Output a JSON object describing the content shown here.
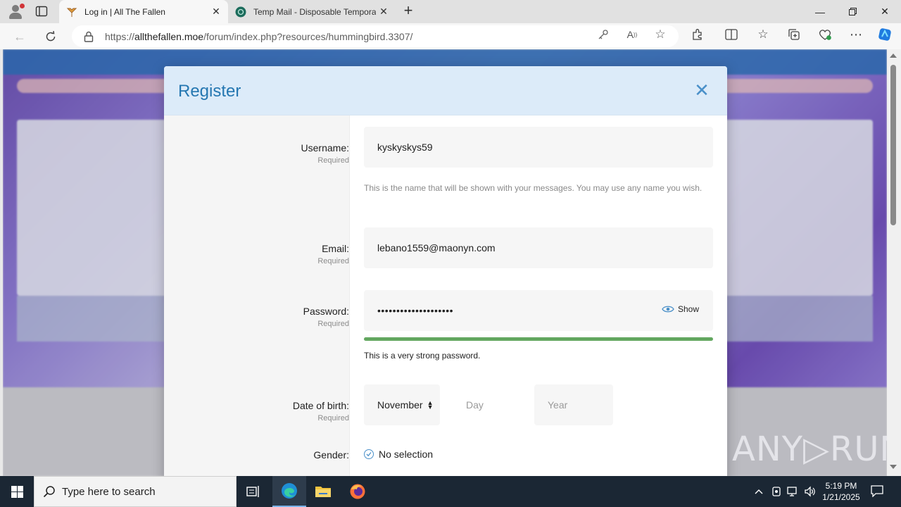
{
  "browser": {
    "tabs": [
      {
        "title": "Log in | All The Fallen",
        "active": true
      },
      {
        "title": "Temp Mail - Disposable Tempora",
        "active": false
      }
    ],
    "url_domain": "allthefallen.moe",
    "url_prefix": "https://",
    "url_path": "/forum/index.php?resources/hummingbird.3307/"
  },
  "modal": {
    "title": "Register",
    "close_glyph": "✕",
    "fields": {
      "username": {
        "label": "Username:",
        "required": "Required",
        "value": "kyskyskys59",
        "hint": "This is the name that will be shown with your messages. You may use any name you wish."
      },
      "email": {
        "label": "Email:",
        "required": "Required",
        "value": "lebano1559@maonyn.com"
      },
      "password": {
        "label": "Password:",
        "required": "Required",
        "value": "••••••••••••••••••••",
        "show_label": "Show",
        "strength_text": "This is a very strong password.",
        "strength_fraction": 1.0,
        "strength_color": "#63a760"
      },
      "dob": {
        "label": "Date of birth:",
        "required": "Required",
        "month": "November",
        "day_placeholder": "Day",
        "year_placeholder": "Year"
      },
      "gender": {
        "label": "Gender:",
        "value": "No selection"
      }
    }
  },
  "watermark": "ANY▷RUN",
  "taskbar": {
    "search_placeholder": "Type here to search",
    "time": "5:19 PM",
    "date": "1/21/2025"
  },
  "colors": {
    "accent": "#2577b1",
    "modal_header_bg": "#dcebf9",
    "taskbar_bg": "#1b2734"
  }
}
